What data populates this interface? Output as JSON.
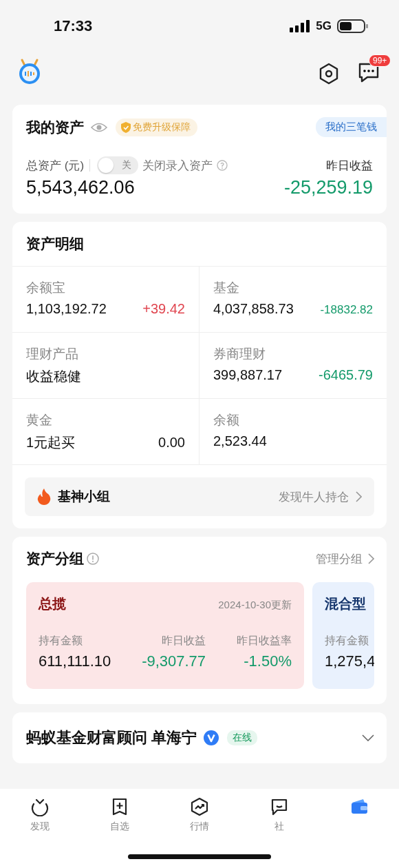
{
  "status_bar": {
    "time": "17:33",
    "network": "5G"
  },
  "header": {
    "message_badge": "99+"
  },
  "assets": {
    "title": "我的资产",
    "badge": "免费升级保障",
    "link": "我的三笔钱",
    "total_label": "总资产 (元)",
    "toggle": {
      "on": false,
      "label": "关"
    },
    "toggle_caption": "关闭录入资产",
    "yesterday_label": "昨日收益",
    "total": "5,543,462.06",
    "yesterday": {
      "text": "-25,259.19",
      "color": "#139a6a"
    }
  },
  "details": {
    "title": "资产明细",
    "cells": [
      {
        "label": "余额宝",
        "value": "1,103,192.72",
        "change": {
          "text": "+39.42",
          "color": "#e0454f"
        }
      },
      {
        "label": "基金",
        "value": "4,037,858.73",
        "change": {
          "text": "-18832.82",
          "color": "#139a6a"
        }
      },
      {
        "label": "理财产品",
        "value": "收益稳健"
      },
      {
        "label": "券商理财",
        "value": "399,887.17",
        "change": {
          "text": "-6465.79",
          "color": "#139a6a"
        }
      },
      {
        "label": "黄金",
        "value": "1元起买",
        "change": {
          "text": "0.00",
          "color": "#111111"
        }
      },
      {
        "label": "余额",
        "value": "2,523.44"
      }
    ],
    "banner": {
      "title": "基神小组",
      "link": "发现牛人持仓"
    }
  },
  "groups": {
    "title": "资产分组",
    "link": "管理分组",
    "cards": [
      {
        "title": "总揽",
        "color": "#fce6e7",
        "updated": "2024-10-30更新",
        "metrics": [
          {
            "label": "持有金额",
            "value": "611,111.10",
            "color": "#111111"
          },
          {
            "label": "昨日收益",
            "value": "-9,307.77",
            "color": "#139a6a"
          },
          {
            "label": "昨日收益率",
            "value": "-1.50%",
            "color": "#139a6a"
          }
        ]
      },
      {
        "title": "混合型",
        "color": "#e9f1fd",
        "metrics": [
          {
            "label": "持有金额",
            "value": "1,275,4",
            "color": "#111111"
          }
        ]
      }
    ]
  },
  "advisor": {
    "name": "蚂蚁基金财富顾问 单海宁",
    "verified": true,
    "status": "在线"
  },
  "tabs": [
    {
      "kind": "discover",
      "label": "发现",
      "selected": false
    },
    {
      "kind": "watchlist",
      "label": "自选",
      "selected": false
    },
    {
      "kind": "market",
      "label": "行情",
      "selected": false
    },
    {
      "kind": "community",
      "label": "社",
      "selected": false
    },
    {
      "kind": "wallet",
      "selected": true
    }
  ]
}
